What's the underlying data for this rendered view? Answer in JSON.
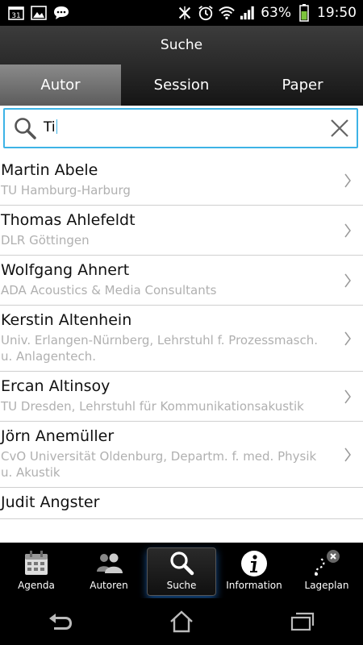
{
  "statusbar": {
    "battery": "63%",
    "time": "19:50"
  },
  "header": {
    "title": "Suche"
  },
  "tabs": [
    {
      "label": "Autor",
      "active": true
    },
    {
      "label": "Session",
      "active": false
    },
    {
      "label": "Paper",
      "active": false
    }
  ],
  "search": {
    "value": "Ti",
    "icon": "search-icon",
    "clear_icon": "close-icon"
  },
  "authors": [
    {
      "name": "Martin Abele",
      "affiliation": "TU Hamburg-Harburg"
    },
    {
      "name": "Thomas Ahlefeldt",
      "affiliation": "DLR Göttingen"
    },
    {
      "name": "Wolfgang Ahnert",
      "affiliation": "ADA Acoustics & Media Consultants"
    },
    {
      "name": "Kerstin Altenhein",
      "affiliation": "Univ. Erlangen-Nürnberg, Lehrstuhl f. Prozessmasch. u. Anlagentech."
    },
    {
      "name": "Ercan Altinsoy",
      "affiliation": "TU Dresden, Lehrstuhl für Kommunikationsakustik"
    },
    {
      "name": "Jörn Anemüller",
      "affiliation": "CvO Universität Oldenburg, Departm. f. med. Physik u. Akustik"
    },
    {
      "name": "Judit Angster",
      "affiliation": ""
    }
  ],
  "nav": [
    {
      "label": "Agenda",
      "icon": "calendar-icon"
    },
    {
      "label": "Autoren",
      "icon": "people-icon"
    },
    {
      "label": "Suche",
      "icon": "search-icon",
      "active": true
    },
    {
      "label": "Information",
      "icon": "info-icon"
    },
    {
      "label": "Lageplan",
      "icon": "map-route-icon"
    }
  ],
  "colors": {
    "accent": "#3db3e6",
    "secondary_text": "#b0b0b0"
  }
}
